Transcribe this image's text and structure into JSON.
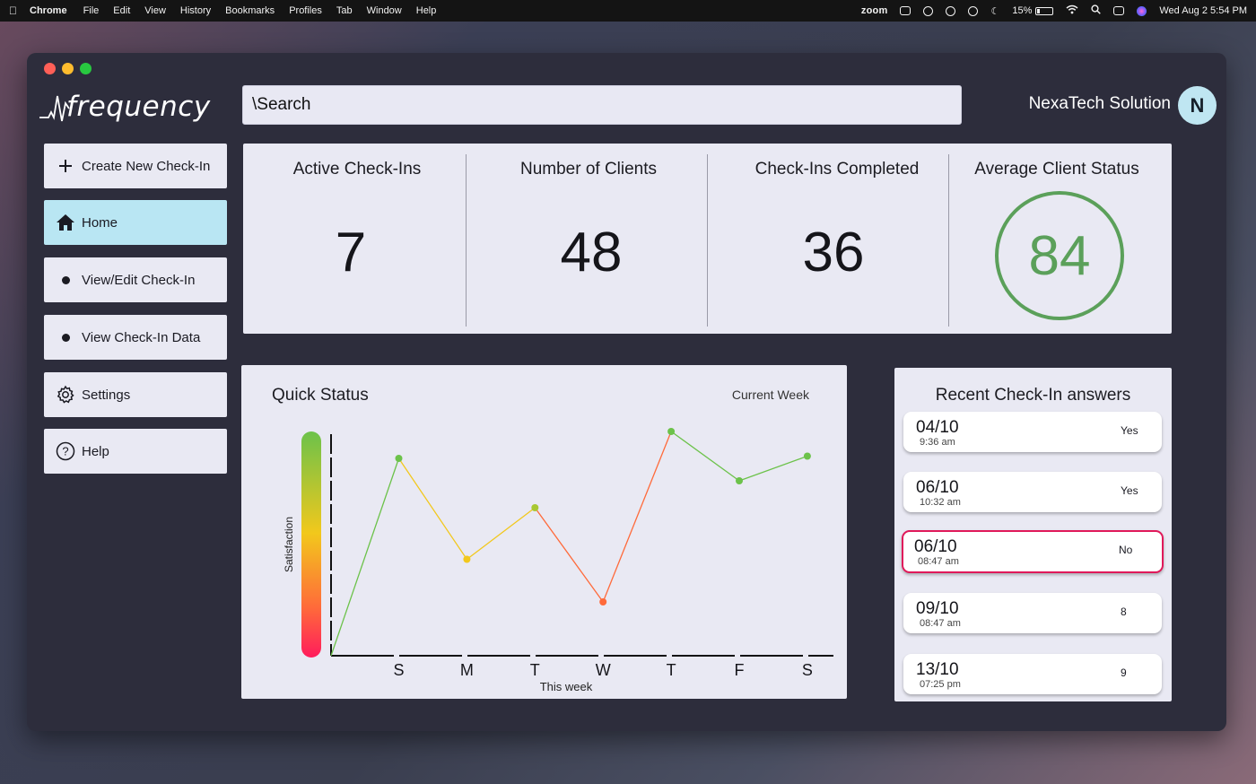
{
  "menubar": {
    "app_name": "Chrome",
    "menus": [
      "File",
      "Edit",
      "View",
      "History",
      "Bookmarks",
      "Profiles",
      "Tab",
      "Window",
      "Help"
    ],
    "zoom_label": "zoom",
    "battery": "15%",
    "datetime": "Wed Aug 2  5:54 PM"
  },
  "app": {
    "logo_text": "frequency",
    "search_value": "\\Search",
    "company_name": "NexaTech Solution",
    "avatar_initial": "N"
  },
  "sidebar": {
    "items": [
      {
        "label": "Create New Check-In",
        "icon": "plus-icon",
        "active": false
      },
      {
        "label": "Home",
        "icon": "home-icon",
        "active": true
      },
      {
        "label": "View/Edit Check-In",
        "icon": "bullet-icon",
        "active": false
      },
      {
        "label": "View Check-In  Data",
        "icon": "bullet-icon",
        "active": false
      },
      {
        "label": "Settings",
        "icon": "gear-icon",
        "active": false
      },
      {
        "label": "Help",
        "icon": "help-icon",
        "active": false
      }
    ]
  },
  "stats": {
    "active_checkins": {
      "label": "Active Check-Ins",
      "value": "7"
    },
    "clients": {
      "label": "Number of Clients",
      "value": "48"
    },
    "completed": {
      "label": "Check-Ins Completed",
      "value": "36"
    },
    "avg_status": {
      "label": "Average Client Status",
      "value": "84",
      "color": "#5ba05a"
    }
  },
  "quick_status": {
    "title": "Quick Status",
    "period": "Current Week"
  },
  "chart_data": {
    "type": "line",
    "categories": [
      "S",
      "M",
      "T",
      "W",
      "T",
      "F",
      "S"
    ],
    "values": [
      88,
      43,
      66,
      24,
      100,
      78,
      89
    ],
    "xlabel": "This week",
    "ylabel": "Satisfaction",
    "ylim": [
      0,
      100
    ],
    "gradient_colors": [
      "#6cc24a",
      "#f2c81c",
      "#ff6a3a",
      "#ff1c5c"
    ]
  },
  "recent": {
    "title": "Recent Check-In answers",
    "entries": [
      {
        "date": "04/10",
        "time": "9:36 am",
        "answer": "Yes",
        "flagged": false
      },
      {
        "date": "06/10",
        "time": "10:32 am",
        "answer": "Yes",
        "flagged": false
      },
      {
        "date": "06/10",
        "time": "08:47 am",
        "answer": "No",
        "flagged": true
      },
      {
        "date": "09/10",
        "time": "08:47 am",
        "answer": "8",
        "flagged": false
      },
      {
        "date": "13/10",
        "time": "07:25 pm",
        "answer": "9",
        "flagged": false
      }
    ]
  }
}
